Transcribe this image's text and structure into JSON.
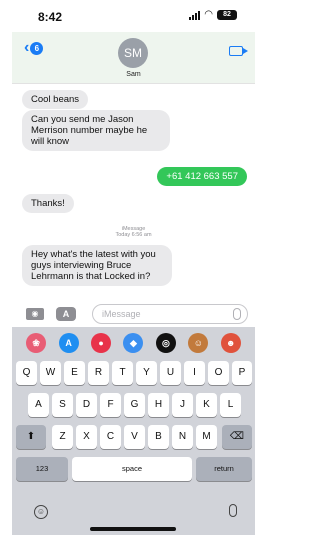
{
  "status": {
    "time": "8:42",
    "battery": "82"
  },
  "header": {
    "back_count": "6",
    "avatar_initials": "SM",
    "contact_name": "Sam"
  },
  "messages": [
    {
      "text": "Cool beans",
      "direction": "received"
    },
    {
      "text": "Can you send me Jason Merrison number maybe he will know",
      "direction": "received"
    },
    {
      "text": "+61 412 663 557",
      "direction": "sent"
    },
    {
      "text": "Thanks!",
      "direction": "received"
    },
    {
      "text": "Hey what's the latest with you guys interviewing Bruce Lehrmann is that Locked in?",
      "direction": "received"
    }
  ],
  "timestamp": {
    "service": "iMessage",
    "time": "Today 6:56 am"
  },
  "composer": {
    "placeholder": "iMessage",
    "apps_glyph": "A"
  },
  "keyboard": {
    "row1": [
      "Q",
      "W",
      "E",
      "R",
      "T",
      "Y",
      "U",
      "I",
      "O",
      "P"
    ],
    "row2": [
      "A",
      "S",
      "D",
      "F",
      "G",
      "H",
      "J",
      "K",
      "L"
    ],
    "row3": [
      "Z",
      "X",
      "C",
      "V",
      "B",
      "N",
      "M"
    ],
    "numbers": "123",
    "space": "space",
    "return": "return",
    "apps": [
      {
        "name": "photos",
        "color": "#e85d75"
      },
      {
        "name": "app-store",
        "color": "#1f8ef1"
      },
      {
        "name": "stickers",
        "color": "#e8334a"
      },
      {
        "name": "shazam",
        "color": "#3b8ff0"
      },
      {
        "name": "fitness",
        "color": "#111111"
      },
      {
        "name": "memoji",
        "color": "#c27a3c"
      },
      {
        "name": "avatar",
        "color": "#e0523c"
      }
    ]
  },
  "colors": {
    "accent": "#1a7cf5",
    "sent_bubble": "#33c759",
    "received_bubble": "#e9e9eb"
  }
}
